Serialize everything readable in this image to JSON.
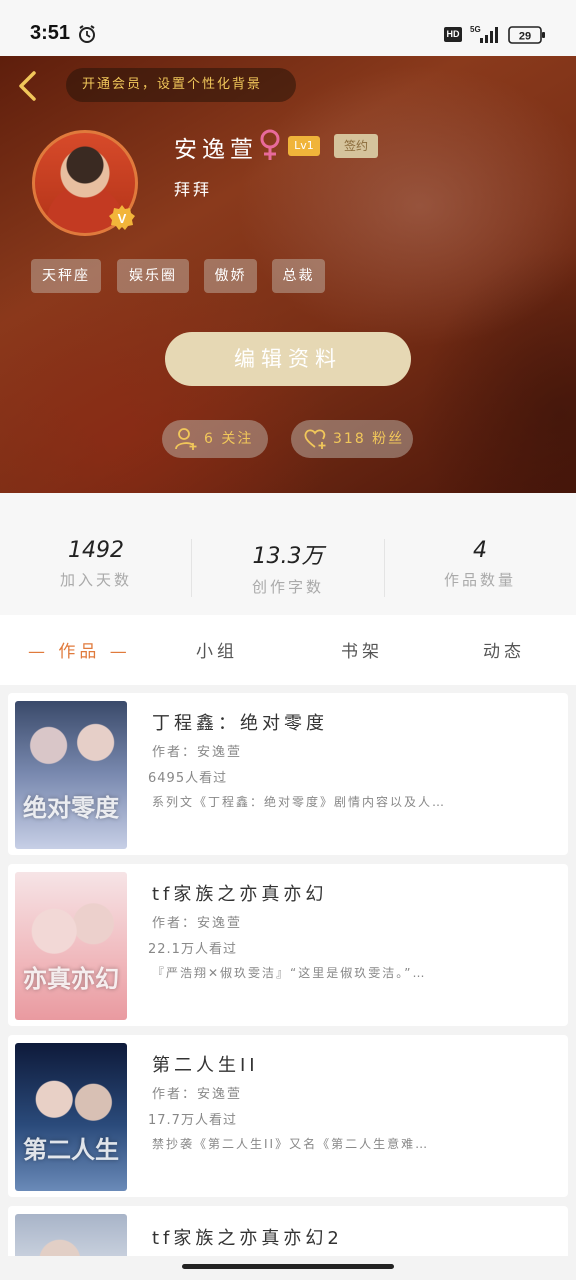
{
  "status_bar": {
    "time": "3:51",
    "battery": "29",
    "network": "5G",
    "hd": "HD"
  },
  "header": {
    "member_banner": "开通会员，设置个性化背景",
    "username": "安逸萱",
    "level": "Lv1",
    "contract": "签约",
    "signature": "拜拜",
    "tags": [
      "天秤座",
      "娱乐圈",
      "傲娇",
      "总裁"
    ],
    "edit_button": "编辑资料",
    "following": "6 关注",
    "followers": "318 粉丝"
  },
  "stats": [
    {
      "value": "1492",
      "label": "加入天数"
    },
    {
      "value": "13.3万",
      "label": "创作字数"
    },
    {
      "value": "4",
      "label": "作品数量"
    }
  ],
  "tabs": [
    "— 作品 —",
    "小组",
    "书架",
    "动态"
  ],
  "works": [
    {
      "title": "丁程鑫：绝对零度",
      "author": "作者：安逸萱",
      "views": "6495人看过",
      "desc": "系列文《丁程鑫：绝对零度》剧情内容以及人…",
      "cover_text": "绝对零度"
    },
    {
      "title": "tf家族之亦真亦幻",
      "author": "作者：安逸萱",
      "views": "22.1万人看过",
      "desc": "『严浩翔✕俶玖雯洁』“这里是俶玖雯洁。”…",
      "cover_text": "亦真亦幻"
    },
    {
      "title": "第二人生II",
      "author": "作者：安逸萱",
      "views": "17.7万人看过",
      "desc": "禁抄袭《第二人生II》又名《第二人生意难…",
      "cover_text": "第二人生"
    },
    {
      "title": "tf家族之亦真亦幻2",
      "author": "",
      "views": "",
      "desc": "",
      "cover_text": ""
    }
  ],
  "colors": {
    "accent": "#e07a3c",
    "gold": "#f1c75a",
    "button": "#e6d8b4"
  }
}
